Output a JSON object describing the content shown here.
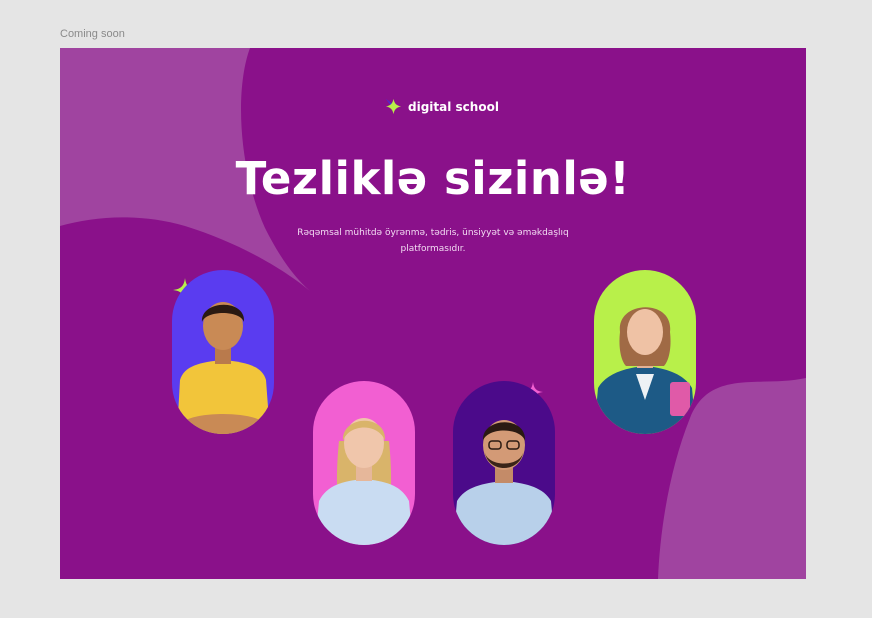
{
  "frame": {
    "label": "Coming soon"
  },
  "brand": {
    "name": "digital school"
  },
  "hero": {
    "title": "Tezliklə sizinlə!",
    "subtitle": "Rəqəmsal mühitdə öyrənmə, tədris, ünsiyyət və əməkdaşlıq platformasıdır."
  },
  "people": [
    {
      "name": "boy-portrait",
      "background": "#5a3cf0",
      "shirt": "#f2c53a"
    },
    {
      "name": "young-woman-portrait",
      "background": "#f25fd2",
      "shirt": "#c9dcf2"
    },
    {
      "name": "man-glasses-portrait",
      "background": "#4b0a8a",
      "shirt": "#b8d0ea"
    },
    {
      "name": "older-woman-portrait",
      "background": "#b8f04a",
      "shirt": "#1d5a86"
    }
  ],
  "colors": {
    "page_background": "#e5e5e5",
    "frame_background": "#8a118a",
    "light_shape": "#a044a0",
    "accent_lime": "#b8f04a",
    "accent_pink": "#f25fd2",
    "accent_violet": "#5a3cf0"
  }
}
